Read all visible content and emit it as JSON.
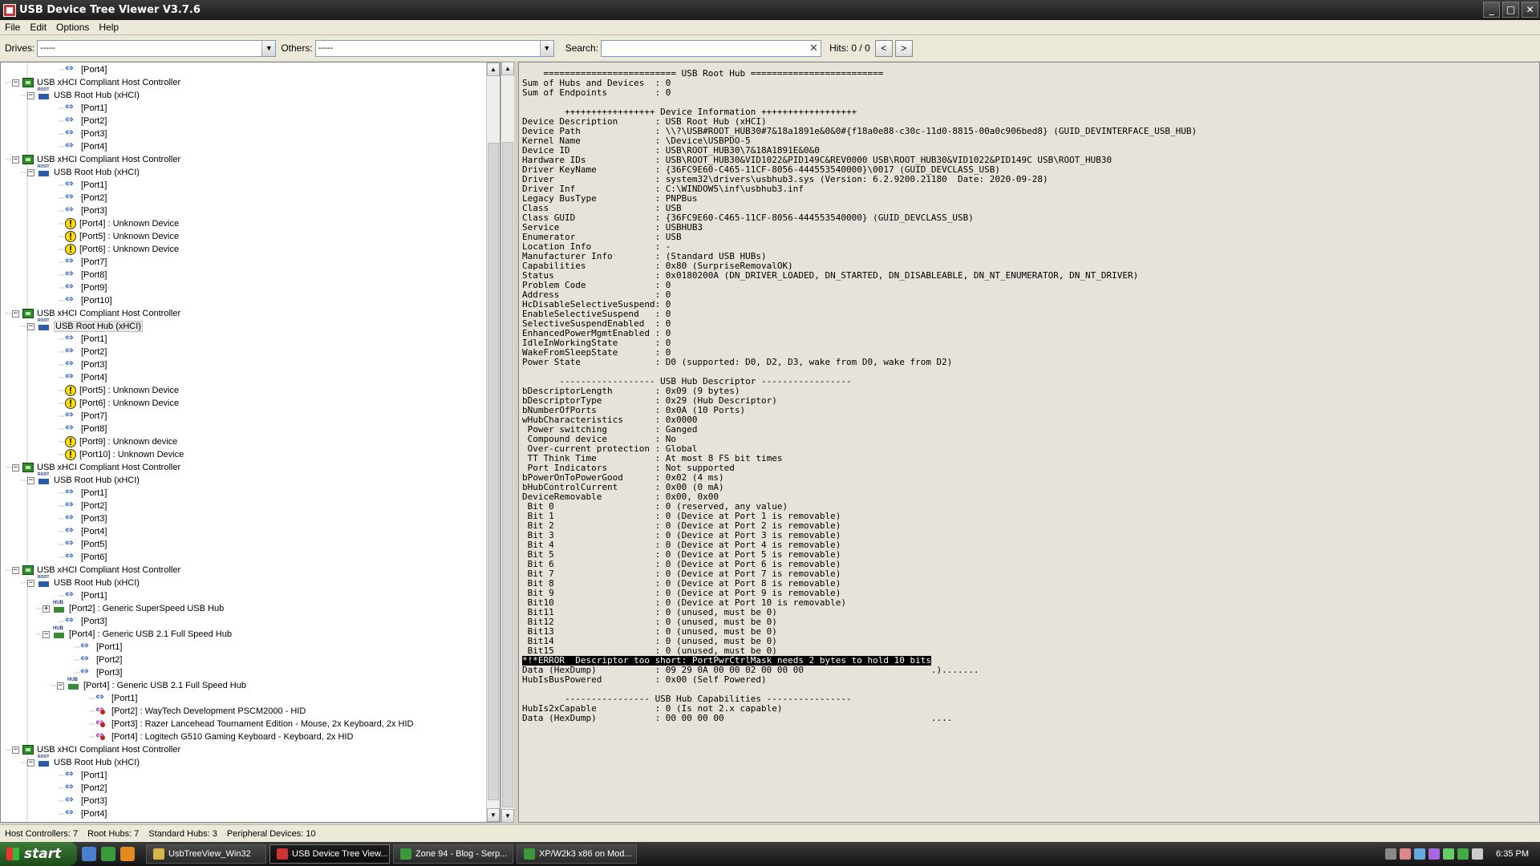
{
  "window": {
    "title": "USB Device Tree Viewer V3.7.6",
    "minimize": "_",
    "maximize": "□",
    "close": "✕"
  },
  "menu": [
    "File",
    "Edit",
    "Options",
    "Help"
  ],
  "toolbar": {
    "drives_label": "Drives:",
    "drives_value": "-----",
    "others_label": "Others:",
    "others_value": "-----",
    "search_label": "Search:",
    "search_value": "",
    "hits_label": "Hits: 0 / 0",
    "prev": "<",
    "next": ">"
  },
  "tree": [
    {
      "level": 4,
      "icon": "port",
      "label": "[Port4]"
    },
    {
      "level": 1,
      "icon": "hc",
      "label": "USB xHCI Compliant Host Controller",
      "exp": "−"
    },
    {
      "level": 2,
      "icon": "root",
      "label": "USB Root Hub (xHCI)",
      "exp": "−"
    },
    {
      "level": 4,
      "icon": "port",
      "label": "[Port1]"
    },
    {
      "level": 4,
      "icon": "port",
      "label": "[Port2]"
    },
    {
      "level": 4,
      "icon": "port",
      "label": "[Port3]"
    },
    {
      "level": 4,
      "icon": "port",
      "label": "[Port4]"
    },
    {
      "level": 1,
      "icon": "hc",
      "label": "USB xHCI Compliant Host Controller",
      "exp": "−"
    },
    {
      "level": 2,
      "icon": "root",
      "label": "USB Root Hub (xHCI)",
      "exp": "−"
    },
    {
      "level": 4,
      "icon": "port",
      "label": "[Port1]"
    },
    {
      "level": 4,
      "icon": "port",
      "label": "[Port2]"
    },
    {
      "level": 4,
      "icon": "port",
      "label": "[Port3]"
    },
    {
      "level": 4,
      "icon": "warn",
      "label": "[Port4] : Unknown Device"
    },
    {
      "level": 4,
      "icon": "warn",
      "label": "[Port5] : Unknown Device"
    },
    {
      "level": 4,
      "icon": "warn",
      "label": "[Port6] : Unknown Device"
    },
    {
      "level": 4,
      "icon": "port",
      "label": "[Port7]"
    },
    {
      "level": 4,
      "icon": "port",
      "label": "[Port8]"
    },
    {
      "level": 4,
      "icon": "port",
      "label": "[Port9]"
    },
    {
      "level": 4,
      "icon": "port",
      "label": "[Port10]"
    },
    {
      "level": 1,
      "icon": "hc",
      "label": "USB xHCI Compliant Host Controller",
      "exp": "−"
    },
    {
      "level": 2,
      "icon": "root",
      "label": "USB Root Hub (xHCI)",
      "exp": "−",
      "selected": true
    },
    {
      "level": 4,
      "icon": "port",
      "label": "[Port1]"
    },
    {
      "level": 4,
      "icon": "port",
      "label": "[Port2]"
    },
    {
      "level": 4,
      "icon": "port",
      "label": "[Port3]"
    },
    {
      "level": 4,
      "icon": "port",
      "label": "[Port4]"
    },
    {
      "level": 4,
      "icon": "warn",
      "label": "[Port5] : Unknown Device"
    },
    {
      "level": 4,
      "icon": "warn",
      "label": "[Port6] : Unknown Device"
    },
    {
      "level": 4,
      "icon": "port",
      "label": "[Port7]"
    },
    {
      "level": 4,
      "icon": "port",
      "label": "[Port8]"
    },
    {
      "level": 4,
      "icon": "warn",
      "label": "[Port9] : Unknown device"
    },
    {
      "level": 4,
      "icon": "warn",
      "label": "[Port10] : Unknown Device"
    },
    {
      "level": 1,
      "icon": "hc",
      "label": "USB xHCI Compliant Host Controller",
      "exp": "−"
    },
    {
      "level": 2,
      "icon": "root",
      "label": "USB Root Hub (xHCI)",
      "exp": "−"
    },
    {
      "level": 4,
      "icon": "port",
      "label": "[Port1]"
    },
    {
      "level": 4,
      "icon": "port",
      "label": "[Port2]"
    },
    {
      "level": 4,
      "icon": "port",
      "label": "[Port3]"
    },
    {
      "level": 4,
      "icon": "port",
      "label": "[Port4]"
    },
    {
      "level": 4,
      "icon": "port",
      "label": "[Port5]"
    },
    {
      "level": 4,
      "icon": "port",
      "label": "[Port6]"
    },
    {
      "level": 1,
      "icon": "hc",
      "label": "USB xHCI Compliant Host Controller",
      "exp": "−"
    },
    {
      "level": 2,
      "icon": "root",
      "label": "USB Root Hub (xHCI)",
      "exp": "−"
    },
    {
      "level": 4,
      "icon": "port",
      "label": "[Port1]"
    },
    {
      "level": 3,
      "icon": "hub",
      "label": "[Port2] : Generic SuperSpeed USB Hub",
      "exp": "+"
    },
    {
      "level": 4,
      "icon": "port",
      "label": "[Port3]"
    },
    {
      "level": 3,
      "icon": "hub",
      "label": "[Port4] : Generic USB 2.1 Full Speed Hub",
      "exp": "−"
    },
    {
      "level": 5,
      "icon": "port",
      "label": "[Port1]"
    },
    {
      "level": 5,
      "icon": "port",
      "label": "[Port2]"
    },
    {
      "level": 5,
      "icon": "port",
      "label": "[Port3]"
    },
    {
      "level": 4.1,
      "icon": "hub",
      "label": "[Port4] : Generic USB 2.1 Full Speed Hub",
      "exp": "−"
    },
    {
      "level": 6,
      "icon": "port",
      "label": "[Port1]"
    },
    {
      "level": 6,
      "icon": "hid",
      "label": "[Port2] : WayTech Development PSCM2000 - HID"
    },
    {
      "level": 6,
      "icon": "hid",
      "label": "[Port3] : Razer Lancehead Tournament Edition - Mouse, 2x Keyboard, 2x HID"
    },
    {
      "level": 6,
      "icon": "hid",
      "label": "[Port4] : Logitech G510 Gaming Keyboard - Keyboard, 2x HID"
    },
    {
      "level": 1,
      "icon": "hc",
      "label": "USB xHCI Compliant Host Controller",
      "exp": "−"
    },
    {
      "level": 2,
      "icon": "root",
      "label": "USB Root Hub (xHCI)",
      "exp": "−"
    },
    {
      "level": 4,
      "icon": "port",
      "label": "[Port1]"
    },
    {
      "level": 4,
      "icon": "port",
      "label": "[Port2]"
    },
    {
      "level": 4,
      "icon": "port",
      "label": "[Port3]"
    },
    {
      "level": 4,
      "icon": "port",
      "label": "[Port4]"
    }
  ],
  "info_lines": [
    "    ========================= USB Root Hub =========================",
    "Sum of Hubs and Devices  : 0",
    "Sum of Endpoints         : 0",
    "",
    "        +++++++++++++++++ Device Information ++++++++++++++++++",
    "Device Description       : USB Root Hub (xHCI)",
    "Device Path              : \\\\?\\USB#ROOT_HUB30#7&18a1891e&0&0#{f18a0e88-c30c-11d0-8815-00a0c906bed8} (GUID_DEVINTERFACE_USB_HUB)",
    "Kernel Name              : \\Device\\USBPDO-5",
    "Device ID                : USB\\ROOT_HUB30\\7&18A1891E&0&0",
    "Hardware IDs             : USB\\ROOT_HUB30&VID1022&PID149C&REV0000 USB\\ROOT_HUB30&VID1022&PID149C USB\\ROOT_HUB30",
    "Driver KeyName           : {36FC9E60-C465-11CF-8056-444553540000}\\0017 (GUID_DEVCLASS_USB)",
    "Driver                   : system32\\drivers\\usbhub3.sys (Version: 6.2.9200.21180  Date: 2020-09-28)",
    "Driver Inf               : C:\\WINDOWS\\inf\\usbhub3.inf",
    "Legacy BusType           : PNPBus",
    "Class                    : USB",
    "Class GUID               : {36FC9E60-C465-11CF-8056-444553540000} (GUID_DEVCLASS_USB)",
    "Service                  : USBHUB3",
    "Enumerator               : USB",
    "Location Info            : -",
    "Manufacturer Info        : (Standard USB HUBs)",
    "Capabilities             : 0x80 (SurpriseRemovalOK)",
    "Status                   : 0x0180200A (DN_DRIVER_LOADED, DN_STARTED, DN_DISABLEABLE, DN_NT_ENUMERATOR, DN_NT_DRIVER)",
    "Problem Code             : 0",
    "Address                  : 0",
    "HcDisableSelectiveSuspend: 0",
    "EnableSelectiveSuspend   : 0",
    "SelectiveSuspendEnabled  : 0",
    "EnhancedPowerMgmtEnabled : 0",
    "IdleInWorkingState       : 0",
    "WakeFromSleepState       : 0",
    "Power State              : D0 (supported: D0, D2, D3, wake from D0, wake from D2)",
    "",
    "       ------------------ USB Hub Descriptor -----------------",
    "bDescriptorLength        : 0x09 (9 bytes)",
    "bDescriptorType          : 0x29 (Hub Descriptor)",
    "bNumberOfPorts           : 0x0A (10 Ports)",
    "wHubCharacteristics      : 0x0000",
    " Power switching         : Ganged",
    " Compound device         : No",
    " Over-current protection : Global",
    " TT Think Time           : At most 8 FS bit times",
    " Port Indicators         : Not supported",
    "bPowerOnToPowerGood      : 0x02 (4 ms)",
    "bHubControlCurrent       : 0x00 (0 mA)",
    "DeviceRemovable          : 0x00, 0x00",
    " Bit 0                   : 0 (reserved, any value)",
    " Bit 1                   : 0 (Device at Port 1 is removable)",
    " Bit 2                   : 0 (Device at Port 2 is removable)",
    " Bit 3                   : 0 (Device at Port 3 is removable)",
    " Bit 4                   : 0 (Device at Port 4 is removable)",
    " Bit 5                   : 0 (Device at Port 5 is removable)",
    " Bit 6                   : 0 (Device at Port 6 is removable)",
    " Bit 7                   : 0 (Device at Port 7 is removable)",
    " Bit 8                   : 0 (Device at Port 8 is removable)",
    " Bit 9                   : 0 (Device at Port 9 is removable)",
    " Bit10                   : 0 (Device at Port 10 is removable)",
    " Bit11                   : 0 (unused, must be 0)",
    " Bit12                   : 0 (unused, must be 0)",
    " Bit13                   : 0 (unused, must be 0)",
    " Bit14                   : 0 (unused, must be 0)",
    " Bit15                   : 0 (unused, must be 0)",
    "*!*ERROR  Descriptor too short: PortPwrCtrlMask needs 2 bytes to hold 10 bits",
    "Data (HexDump)           : 09 29 0A 00 00 02 00 00 00                        .).......",
    "HubIsBusPowered          : 0x00 (Self Powered)",
    "",
    "        ---------------- USB Hub Capabilities ----------------",
    "HubIs2xCapable           : 0 (Is not 2.x capable)",
    "Data (HexDump)           : 00 00 00 00                                       ...."
  ],
  "status": {
    "host_controllers": "Host Controllers: 7",
    "root_hubs": "Root Hubs: 7",
    "standard_hubs": "Standard Hubs: 3",
    "peripheral_devices": "Peripheral Devices: 10"
  },
  "taskbar": {
    "start": "start",
    "buttons": [
      {
        "label": "UsbTreeView_Win32",
        "active": false,
        "color": "#d8b44a"
      },
      {
        "label": "USB Device Tree View...",
        "active": true,
        "color": "#c33"
      },
      {
        "label": "Zone 94 - Blog - Serp...",
        "active": false,
        "color": "#3a9a3a"
      },
      {
        "label": "XP/W2k3 x86 on Mod...",
        "active": false,
        "color": "#3a9a3a"
      }
    ],
    "clock": "6:35 PM"
  }
}
